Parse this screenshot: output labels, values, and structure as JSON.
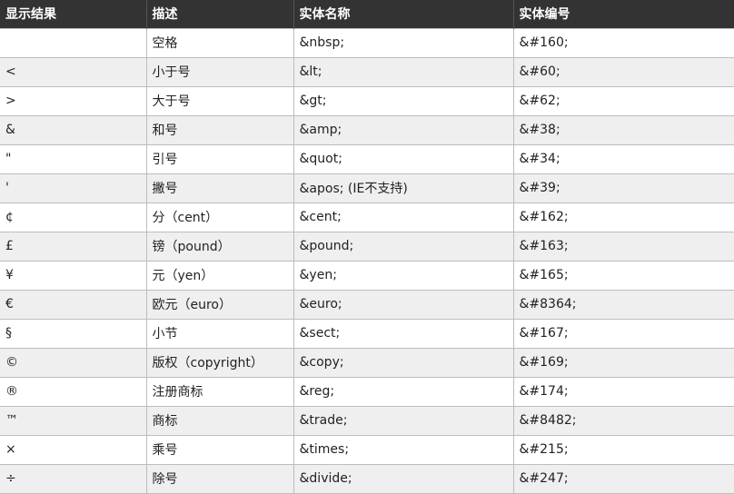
{
  "table": {
    "headers": [
      "显示结果",
      "描述",
      "实体名称",
      "实体编号"
    ],
    "rows": [
      [
        " ",
        "空格",
        "&nbsp;",
        "&#160;"
      ],
      [
        "<",
        "小于号",
        "&lt;",
        "&#60;"
      ],
      [
        ">",
        "大于号",
        "&gt;",
        "&#62;"
      ],
      [
        "&",
        "和号",
        "&amp;",
        "&#38;"
      ],
      [
        "\"",
        "引号",
        "&quot;",
        "&#34;"
      ],
      [
        "'",
        "撇号",
        "&apos; (IE不支持)",
        "&#39;"
      ],
      [
        "¢",
        "分（cent）",
        "&cent;",
        "&#162;"
      ],
      [
        "£",
        "镑（pound）",
        "&pound;",
        "&#163;"
      ],
      [
        "¥",
        "元（yen）",
        "&yen;",
        "&#165;"
      ],
      [
        "€",
        "欧元（euro）",
        "&euro;",
        "&#8364;"
      ],
      [
        "§",
        "小节",
        "&sect;",
        "&#167;"
      ],
      [
        "©",
        "版权（copyright）",
        "&copy;",
        "&#169;"
      ],
      [
        "®",
        "注册商标",
        "&reg;",
        "&#174;"
      ],
      [
        "™",
        "商标",
        "&trade;",
        "&#8482;"
      ],
      [
        "×",
        "乘号",
        "&times;",
        "&#215;"
      ],
      [
        "÷",
        "除号",
        "&divide;",
        "&#247;"
      ]
    ]
  }
}
